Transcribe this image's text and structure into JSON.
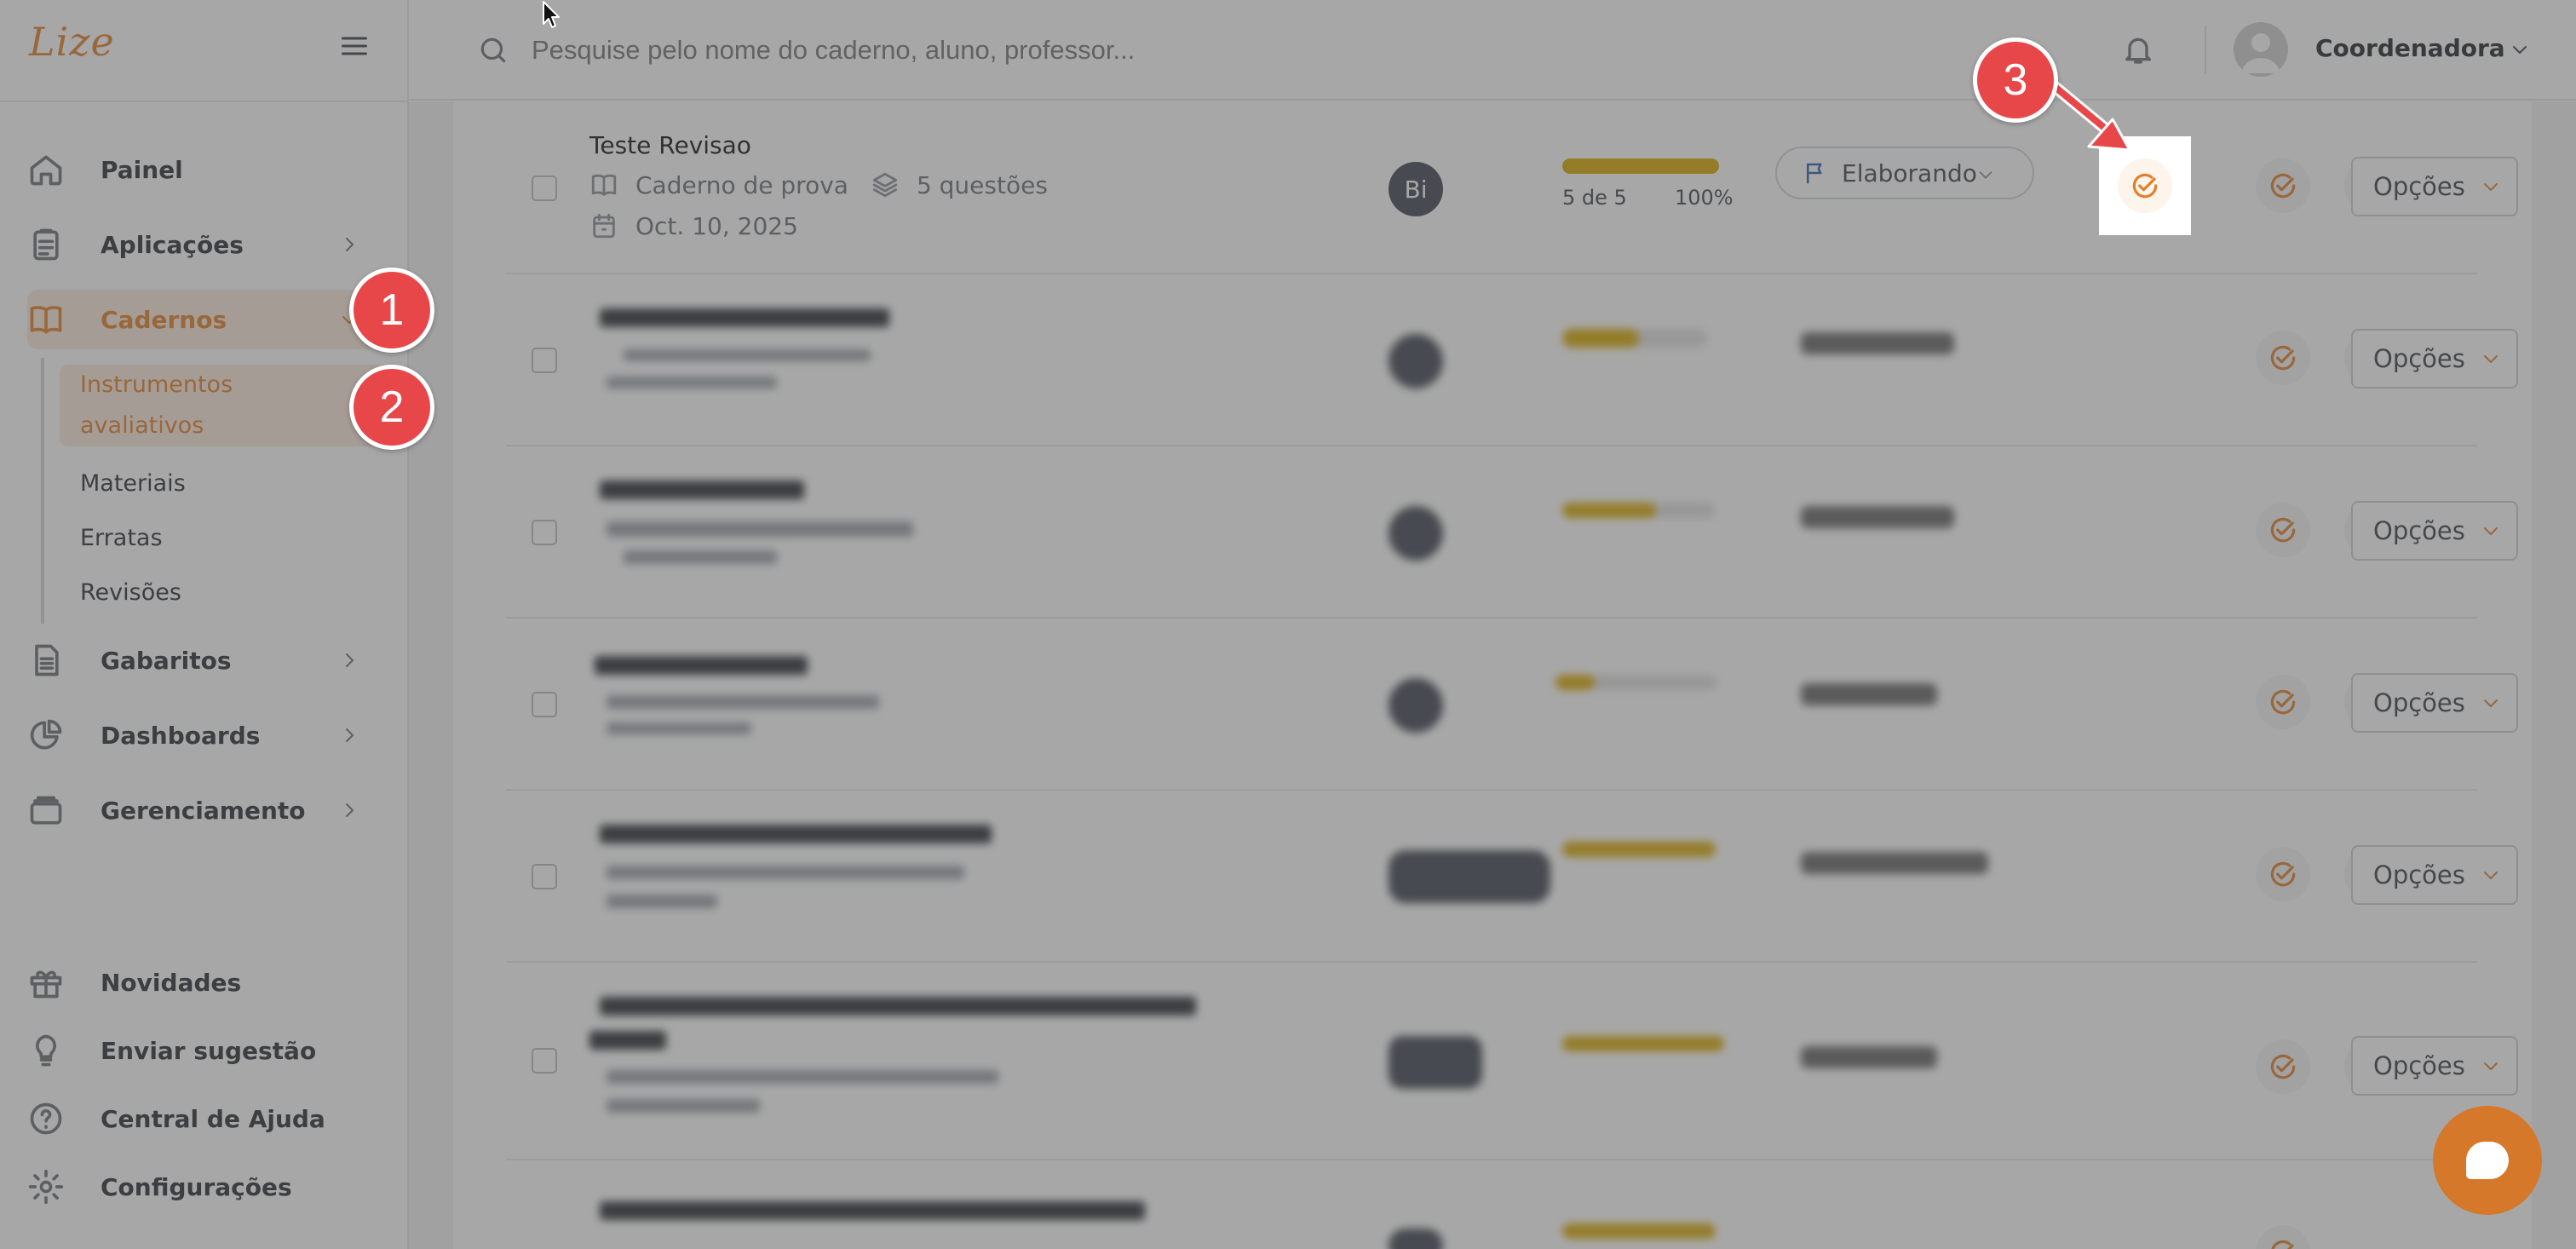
{
  "app": {
    "logo": "Lize"
  },
  "colors": {
    "accent": "#e37f28",
    "marker": "#e8474a",
    "progress": "#d9a800",
    "status_flag": "#2d5fb0"
  },
  "sidebar": {
    "nav": [
      {
        "label": "Painel",
        "icon": "home-icon"
      },
      {
        "label": "Aplicações",
        "icon": "clipboard-icon"
      },
      {
        "label": "Cadernos",
        "icon": "book-icon"
      },
      {
        "label": "Gabaritos",
        "icon": "document-icon"
      },
      {
        "label": "Dashboards",
        "icon": "pie-chart-icon"
      },
      {
        "label": "Gerenciamento",
        "icon": "folder-icon"
      }
    ],
    "sub": [
      "Instrumentos",
      "avaliativos",
      "Materiais",
      "Erratas",
      "Revisões"
    ],
    "bottom": [
      {
        "label": "Novidades",
        "icon": "gift-icon"
      },
      {
        "label": "Enviar sugestão",
        "icon": "lightbulb-icon"
      },
      {
        "label": "Central de Ajuda",
        "icon": "help-icon"
      },
      {
        "label": "Configurações",
        "icon": "gear-icon"
      }
    ]
  },
  "header": {
    "search_placeholder": "Pesquise pelo nome do caderno, aluno, professor...",
    "user": "Coordenadora"
  },
  "rows": [
    {
      "title": "Teste Revisao",
      "type": "Caderno de prova",
      "questions": "5 questões",
      "date": "Oct. 10, 2025",
      "badge": "Bi",
      "progress_text": "5 de 5",
      "progress_pct": "100%",
      "progress": 1.0,
      "status": "Elaborando"
    }
  ],
  "options_label": "Opções",
  "markers": [
    "1",
    "2",
    "3"
  ]
}
